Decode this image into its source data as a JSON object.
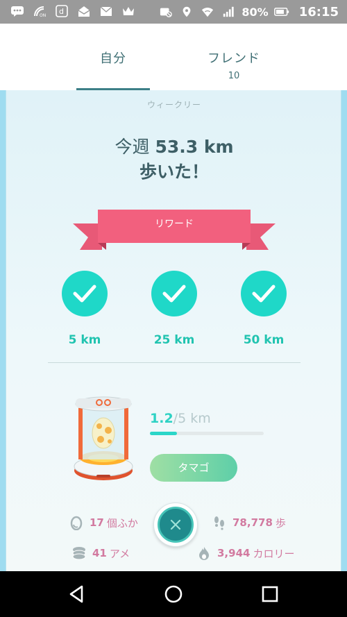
{
  "status_bar": {
    "battery_percent": "80%",
    "time": "16:15",
    "left_icons": [
      "chat-icon",
      "nfc-icon",
      "docomo-icon",
      "mail-open-icon",
      "mail-icon",
      "crown-icon"
    ],
    "right_icons": [
      "photo-blocked-icon",
      "location-icon",
      "wifi-icon",
      "signal-icon",
      "battery-icon"
    ]
  },
  "tabs": [
    {
      "label": "自分",
      "count": "",
      "active": true
    },
    {
      "label": "フレンド",
      "count": "10",
      "active": false
    }
  ],
  "weekly": {
    "section_label": "ウィークリー",
    "headline_prefix": "今週",
    "distance": "53.3 km",
    "headline_suffix": "歩いた！"
  },
  "reward": {
    "ribbon_label": "リワード",
    "milestones": [
      {
        "label": "5 km",
        "achieved": true
      },
      {
        "label": "25 km",
        "achieved": true
      },
      {
        "label": "50 km",
        "achieved": true
      }
    ]
  },
  "egg": {
    "walked": "1.2",
    "total": "/5 km",
    "progress_fraction": 0.24,
    "button_label": "タマゴ"
  },
  "stats": {
    "hatched_count": "17",
    "hatched_unit": "個ふか",
    "steps_count": "78,778",
    "steps_unit": "歩",
    "candy_count": "41",
    "candy_unit": "アメ",
    "calories_count": "3,944",
    "calories_unit": "カロリー"
  },
  "colors": {
    "accent_teal": "#1fd8c8",
    "ribbon_pink": "#f2607e",
    "stat_pink": "#d27aa0",
    "tab_text": "#3f6f74"
  },
  "nav_bar": [
    "back-icon",
    "home-icon",
    "recents-icon"
  ]
}
